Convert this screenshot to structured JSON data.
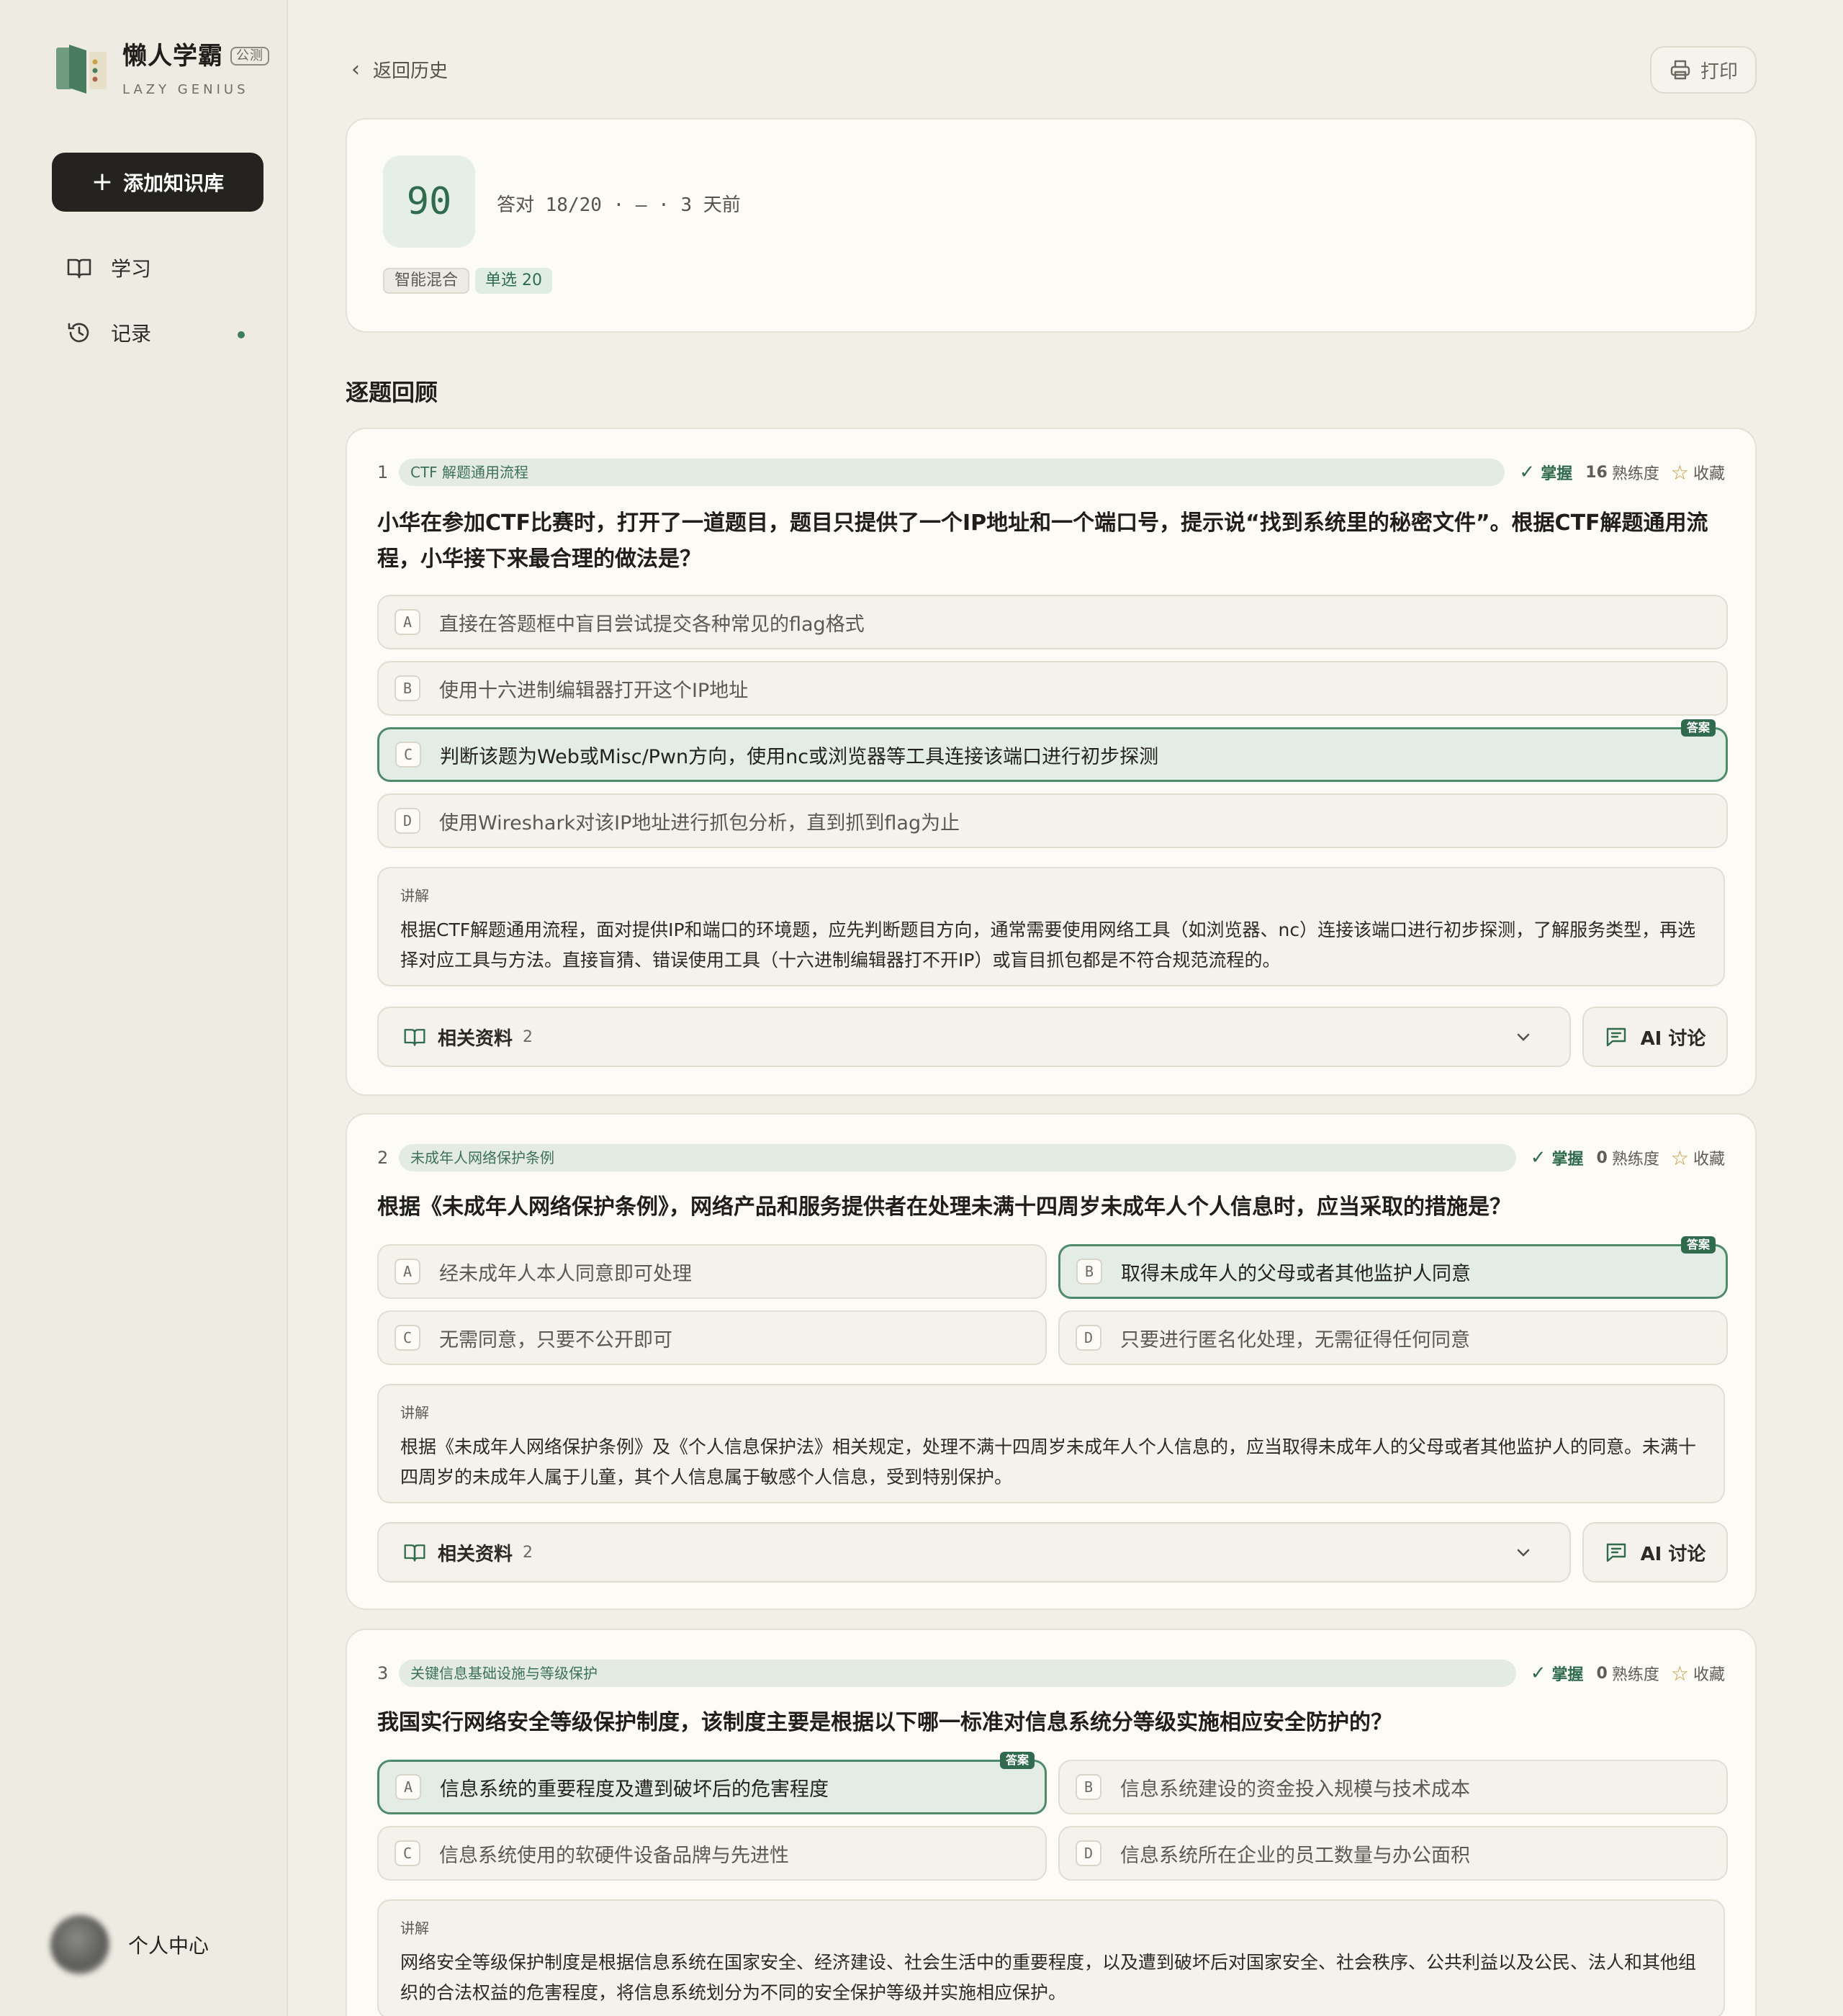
{
  "brand": {
    "name": "懒人学霸",
    "badge": "公测",
    "sub": "LAZY GENIUS"
  },
  "sidebar": {
    "add_button": "添加知识库",
    "items": [
      {
        "label": "学习",
        "icon": "book-icon"
      },
      {
        "label": "记录",
        "icon": "history-icon"
      }
    ],
    "profile": "个人中心"
  },
  "topbar": {
    "back": "返回历史",
    "print": "打印"
  },
  "summary": {
    "score": "90",
    "meta": "答对 18/20 · — · 3 天前",
    "tags": [
      "智能混合",
      "单选 20"
    ]
  },
  "section_title": "逐题回顾",
  "labels": {
    "mastery": "掌握",
    "proficiency": "熟练度",
    "favorite": "收藏",
    "answer": "答案",
    "explain": "讲解",
    "refs": "相关资料",
    "ai": "AI 讨论"
  },
  "questions": [
    {
      "num": "1",
      "category": "CTF 解题通用流程",
      "proficiency": "16",
      "text": "小华在参加CTF比赛时，打开了一道题目，题目只提供了一个IP地址和一个端口号，提示说“找到系统里的秘密文件”。根据CTF解题通用流程，小华接下来最合理的做法是？",
      "options": [
        {
          "letter": "A",
          "text": "直接在答题框中盲目尝试提交各种常见的flag格式"
        },
        {
          "letter": "B",
          "text": "使用十六进制编辑器打开这个IP地址"
        },
        {
          "letter": "C",
          "text": "判断该题为Web或Misc/Pwn方向，使用nc或浏览器等工具连接该端口进行初步探测"
        },
        {
          "letter": "D",
          "text": "使用Wireshark对该IP地址进行抓包分析，直到抓到flag为止"
        }
      ],
      "explain": "根据CTF解题通用流程，面对提供IP和端口的环境题，应先判断题目方向，通常需要使用网络工具（如浏览器、nc）连接该端口进行初步探测，了解服务类型，再选择对应工具与方法。直接盲猜、错误使用工具（十六进制编辑器打不开IP）或盲目抓包都是不符合规范流程的。",
      "refs_count": "2"
    },
    {
      "num": "2",
      "category": "未成年人网络保护条例",
      "proficiency": "0",
      "text": "根据《未成年人网络保护条例》，网络产品和服务提供者在处理未满十四周岁未成年人个人信息时，应当采取的措施是？",
      "options": [
        {
          "letter": "A",
          "text": "经未成年人本人同意即可处理"
        },
        {
          "letter": "B",
          "text": "取得未成年人的父母或者其他监护人同意"
        },
        {
          "letter": "C",
          "text": "无需同意，只要不公开即可"
        },
        {
          "letter": "D",
          "text": "只要进行匿名化处理，无需征得任何同意"
        }
      ],
      "explain": "根据《未成年人网络保护条例》及《个人信息保护法》相关规定，处理不满十四周岁未成年人个人信息的，应当取得未成年人的父母或者其他监护人的同意。未满十四周岁的未成年人属于儿童，其个人信息属于敏感个人信息，受到特别保护。",
      "refs_count": "2"
    },
    {
      "num": "3",
      "category": "关键信息基础设施与等级保护",
      "proficiency": "0",
      "text": "我国实行网络安全等级保护制度，该制度主要是根据以下哪一标准对信息系统分等级实施相应安全防护的？",
      "options": [
        {
          "letter": "A",
          "text": "信息系统的重要程度及遭到破坏后的危害程度"
        },
        {
          "letter": "B",
          "text": "信息系统建设的资金投入规模与技术成本"
        },
        {
          "letter": "C",
          "text": "信息系统使用的软硬件设备品牌与先进性"
        },
        {
          "letter": "D",
          "text": "信息系统所在企业的员工数量与办公面积"
        }
      ],
      "explain": "网络安全等级保护制度是根据信息系统在国家安全、经济建设、社会生活中的重要程度，以及遭到破坏后对国家安全、社会秩序、公共利益以及公民、法人和其他组织的合法权益的危害程度，将信息系统划分为不同的安全保护等级并实施相应保护。"
    }
  ]
}
